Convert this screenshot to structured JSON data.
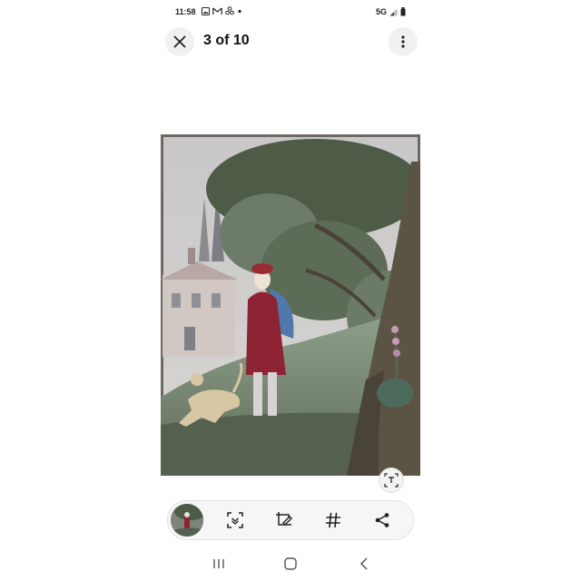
{
  "status_bar": {
    "time": "11:58",
    "left_icons": [
      "image-icon",
      "mail-icon",
      "network-icon",
      "dot-icon"
    ],
    "network": "5G",
    "right_icons": [
      "signal-icon",
      "battery-icon"
    ]
  },
  "header": {
    "counter": "3 of 10",
    "close_icon": "close-icon",
    "more_icon": "more-vertical-icon"
  },
  "image": {
    "description_icon": "painting",
    "ocr_icon": "text-extract-icon"
  },
  "toolbar": {
    "items": [
      {
        "icon": "thumbnail"
      },
      {
        "icon": "scan-icon"
      },
      {
        "icon": "edit-icon"
      },
      {
        "icon": "hashtag-icon"
      },
      {
        "icon": "share-icon"
      }
    ]
  },
  "nav_bar": {
    "items": [
      "recent-apps-icon",
      "home-icon",
      "back-icon"
    ]
  },
  "colors": {
    "background": "#ffffff",
    "toolbar_bg": "#f6f6f6",
    "icon": "#222222"
  }
}
